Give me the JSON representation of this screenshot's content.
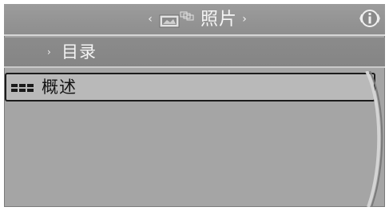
{
  "header": {
    "title": "照片",
    "prev_arrow": "‹",
    "next_arrow": "›",
    "icon": "photo-icon",
    "info_icon": "info-icon"
  },
  "menu": {
    "items": [
      {
        "label": "目录",
        "icon": "chevron-right-icon",
        "chevron": "›"
      },
      {
        "label": "概述",
        "icon": "grid-view-icon",
        "selected": true
      }
    ]
  },
  "colors": {
    "screen_bg": "#a5a5a5",
    "header_bg": "#8e8e8e",
    "selected_row_bg": "#b9b9b9",
    "selected_border": "#1c1c1c",
    "text_light": "#f4f4f4",
    "text_dark": "#141414"
  }
}
